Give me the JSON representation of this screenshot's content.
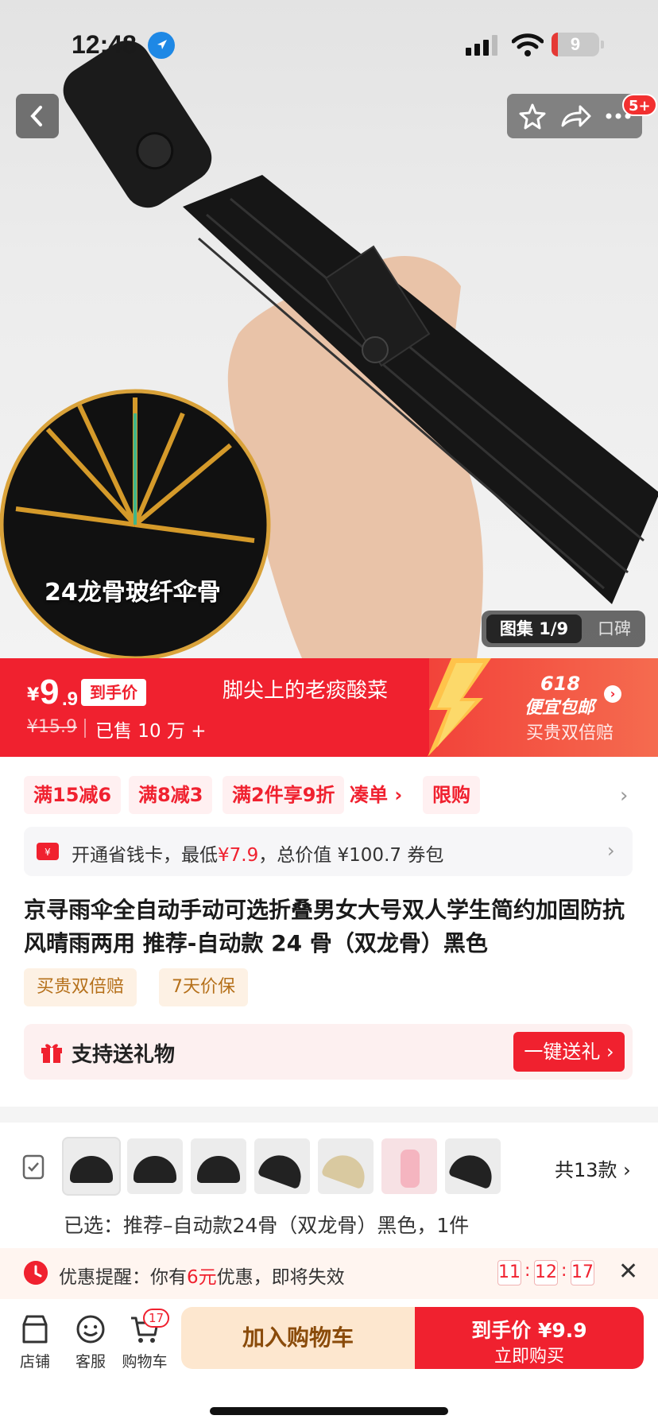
{
  "status_bar": {
    "time": "12:48",
    "battery": "9"
  },
  "header": {
    "notification_badge": "5+"
  },
  "hero": {
    "overlay_text": "24龙骨玻纤伞骨",
    "gallery_label": "图集 1/9",
    "review_tab": "口碑"
  },
  "price": {
    "currency": "¥",
    "integer": "9",
    "decimal": ".9",
    "hand_tag": "到手价",
    "original": "¥15.9",
    "sold": "已售 10 万 +",
    "shop_name": "脚尖上的老痰酸菜",
    "promo_618": "618",
    "promo_sub": "便宜包邮",
    "promo_tag": "买贵双倍赔"
  },
  "coupons": [
    "满15减6",
    "满8减3",
    "满2件享9折",
    "凑单 ›",
    "限购"
  ],
  "save_card": {
    "prefix": "开通省钱卡，最低",
    "price": "¥7.9",
    "suffix": "，总价值 ¥100.7 券包"
  },
  "product": {
    "title": "京寻雨伞全自动手动可选折叠男女大号双人学生简约加固防抗风晴雨两用 推荐-自动款 24 骨（双龙骨）黑色"
  },
  "service_tags": [
    "买贵双倍赔",
    "7天价保"
  ],
  "gift": {
    "label": "支持送礼物",
    "button": "一键送礼"
  },
  "variants": {
    "count_label": "共13款",
    "selected": "已选：推荐–自动款24骨（双龙骨）黑色，1件"
  },
  "reminder": {
    "prefix": "优惠提醒：你有",
    "amount": "6元",
    "suffix": "优惠，即将失效",
    "hours": "11",
    "minutes": "12",
    "seconds": "17"
  },
  "bottom_bar": {
    "store": "店铺",
    "service": "客服",
    "cart": "购物车",
    "cart_count": "17",
    "add_to_cart": "加入购物车",
    "buy_line1": "到手价 ¥9.9",
    "buy_line2": "立即购买"
  },
  "colors": {
    "accent_red": "#f0212f",
    "cart_button": "#fde7cf"
  }
}
